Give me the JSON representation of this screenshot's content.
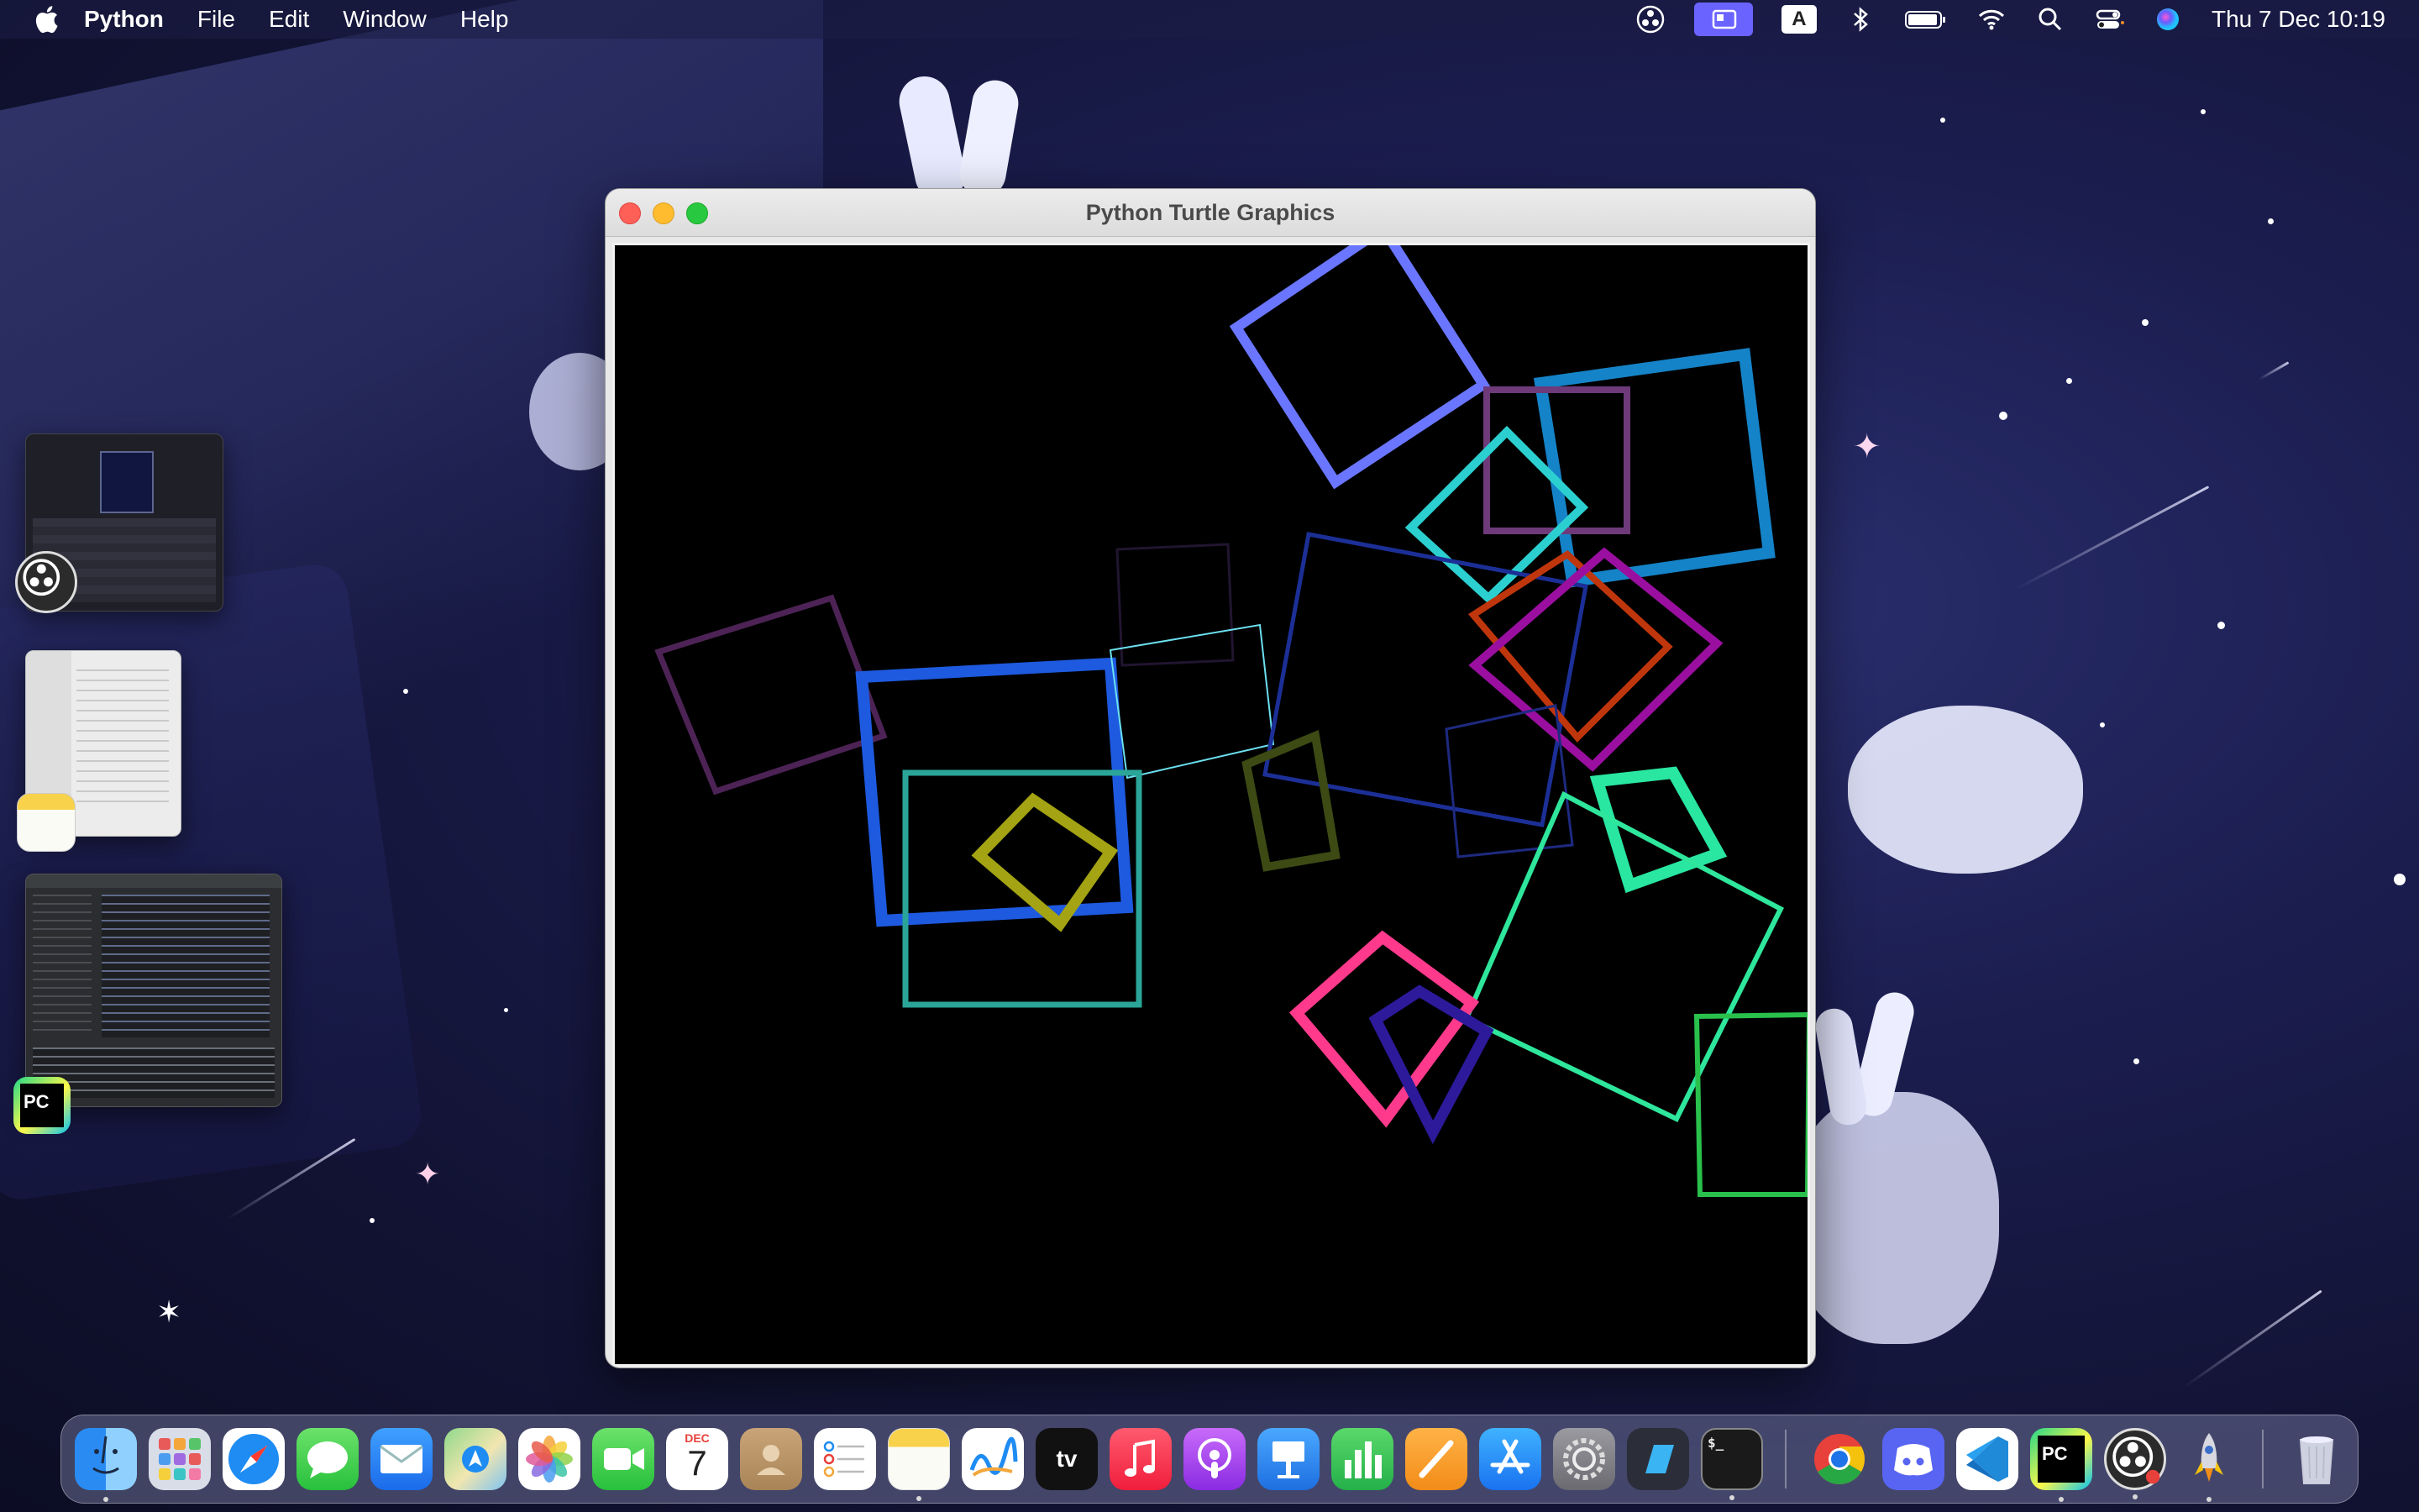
{
  "menubar": {
    "app_name": "Python",
    "menus": [
      "File",
      "Edit",
      "Window",
      "Help"
    ],
    "input_source": "A",
    "clock": "Thu 7 Dec  10:19"
  },
  "window": {
    "title": "Python Turtle Graphics"
  },
  "turtle_squares": [
    {
      "color": "#6a76ff",
      "stroke": 12
    },
    {
      "color": "#1583c8",
      "stroke": 14
    },
    {
      "color": "#6e3a7a",
      "stroke": 8
    },
    {
      "color": "#2ccfcf",
      "stroke": 10
    },
    {
      "color": "#4d2356",
      "stroke": 7
    },
    {
      "color": "#1e5ae0",
      "stroke": 14
    },
    {
      "color": "#211530",
      "stroke": 3
    },
    {
      "color": "#6ce0f0",
      "stroke": 2
    },
    {
      "color": "#1c2f96",
      "stroke": 5
    },
    {
      "color": "#c0360c",
      "stroke": 8
    },
    {
      "color": "#9a0fa0",
      "stroke": 10
    },
    {
      "color": "#1e2a80",
      "stroke": 3
    },
    {
      "color": "#2aa598",
      "stroke": 7
    },
    {
      "color": "#a3a313",
      "stroke": 13
    },
    {
      "color": "#3d4a14",
      "stroke": 10
    },
    {
      "color": "#29e6a0",
      "stroke": 14
    },
    {
      "color": "#2ee69c",
      "stroke": 6
    },
    {
      "color": "#29c04c",
      "stroke": 6
    },
    {
      "color": "#ff3a8c",
      "stroke": 13
    },
    {
      "color": "#2c1a9a",
      "stroke": 13
    }
  ],
  "calendar_icon": {
    "month": "DEC",
    "day": "7"
  },
  "appletv_label": "tv",
  "terminal_prompt": "$_",
  "pycharm_label": "PC",
  "dock": [
    {
      "name": "finder",
      "running": true
    },
    {
      "name": "launchpad",
      "running": false
    },
    {
      "name": "safari",
      "running": false
    },
    {
      "name": "messages",
      "running": false
    },
    {
      "name": "mail",
      "running": false
    },
    {
      "name": "maps",
      "running": false
    },
    {
      "name": "photos",
      "running": false
    },
    {
      "name": "facetime",
      "running": false
    },
    {
      "name": "calendar",
      "running": false
    },
    {
      "name": "contacts",
      "running": false
    },
    {
      "name": "reminders",
      "running": false
    },
    {
      "name": "notes",
      "running": true
    },
    {
      "name": "freeform",
      "running": false
    },
    {
      "name": "apple-tv",
      "running": false
    },
    {
      "name": "music",
      "running": false
    },
    {
      "name": "podcasts",
      "running": false
    },
    {
      "name": "keynote",
      "running": false
    },
    {
      "name": "numbers",
      "running": false
    },
    {
      "name": "pages",
      "running": false
    },
    {
      "name": "app-store",
      "running": false
    },
    {
      "name": "system-settings",
      "running": false
    },
    {
      "name": "parallels-desktop",
      "running": false
    },
    {
      "name": "terminal",
      "running": true
    },
    {
      "name": "chrome",
      "running": false
    },
    {
      "name": "discord",
      "running": false
    },
    {
      "name": "vscode",
      "running": false
    },
    {
      "name": "pycharm",
      "running": true
    },
    {
      "name": "obs",
      "running": true
    },
    {
      "name": "python-launcher",
      "running": true
    },
    {
      "name": "trash",
      "running": false
    }
  ]
}
